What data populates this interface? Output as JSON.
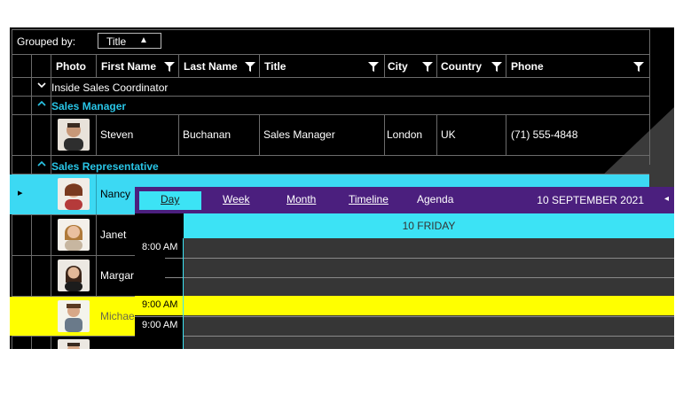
{
  "grouping": {
    "label": "Grouped by:",
    "chip": "Title",
    "chip_sort": "▲"
  },
  "columns": [
    {
      "label": "Photo",
      "filter": false
    },
    {
      "label": "First Name",
      "filter": true
    },
    {
      "label": "Last Name",
      "filter": true
    },
    {
      "label": "Title",
      "filter": true
    },
    {
      "label": "City",
      "filter": true
    },
    {
      "label": "Country",
      "filter": true
    },
    {
      "label": "Phone",
      "filter": true
    }
  ],
  "groups": {
    "inside": {
      "expander": "⌄",
      "label": "Inside Sales Coordinator"
    },
    "manager": {
      "expander": "⌃",
      "label": "Sales Manager"
    },
    "rep": {
      "expander": "⌃",
      "label": "Sales Representative"
    }
  },
  "rows": {
    "steven": {
      "first": "Steven",
      "last": "Buchanan",
      "title": "Sales Manager",
      "city": "London",
      "country": "UK",
      "phone": "(71) 555-4848"
    },
    "nancy": {
      "first": "Nancy"
    },
    "janet": {
      "first": "Janet"
    },
    "margaret": {
      "first": "Margar"
    },
    "michael": {
      "first": "Michae"
    }
  },
  "row_indicator": "▸",
  "scheduler": {
    "views": [
      "Day",
      "Week",
      "Month",
      "Timeline",
      "Agenda"
    ],
    "active_view": "Day",
    "date": "10 SEPTEMBER 2021",
    "nav_arrow": "◂",
    "day_header": "10 FRIDAY",
    "times": [
      "8:00 AM",
      "9:00 AM"
    ]
  },
  "colors": {
    "accent": "#3ce3f5",
    "header_purple": "#4b1f7e",
    "highlight": "#ffff00",
    "group_text": "#29c5e6"
  }
}
